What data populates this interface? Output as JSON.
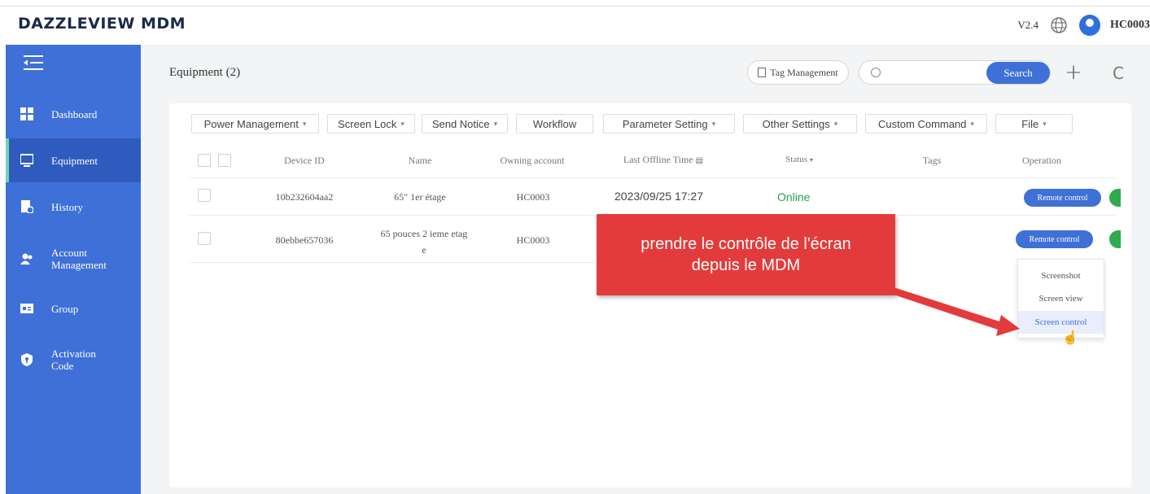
{
  "header": {
    "brand": "DAZZLEVIEW MDM",
    "version": "V2.4",
    "user": "HC0003"
  },
  "sidebar": {
    "items": [
      {
        "label": "Dashboard",
        "icon": "dashboard-icon"
      },
      {
        "label": "Equipment",
        "icon": "monitor-icon",
        "active": true
      },
      {
        "label": "History",
        "icon": "history-icon"
      },
      {
        "label": "Account\nManagement",
        "label_line1": "Account",
        "label_line2": "Management",
        "icon": "account-icon"
      },
      {
        "label": "Group",
        "icon": "group-icon"
      },
      {
        "label": "Activation\nCode",
        "label_line1": "Activation",
        "label_line2": "Code",
        "icon": "shield-icon"
      }
    ]
  },
  "main": {
    "title": "Equipment (2)",
    "tag_management": "Tag Management",
    "search_placeholder": "",
    "search_label": "Search",
    "plus": "+",
    "refresh": "C"
  },
  "toolbar": [
    {
      "label": "Power Management",
      "dropdown": true
    },
    {
      "label": "Screen Lock",
      "dropdown": true
    },
    {
      "label": "Send Notice",
      "dropdown": true
    },
    {
      "label": "Workflow",
      "dropdown": false
    },
    {
      "label": "Parameter Setting",
      "dropdown": true
    },
    {
      "label": "Other Settings",
      "dropdown": true
    },
    {
      "label": "Custom Command",
      "dropdown": true
    },
    {
      "label": "File",
      "dropdown": true
    }
  ],
  "table": {
    "columns": [
      "Device ID",
      "Name",
      "Owning account",
      "Last Offline Time",
      "Status",
      "Tags",
      "Operation"
    ],
    "rows": [
      {
        "device_id": "10b232604aa2",
        "name": "65\" 1er étage",
        "owner": "HC0003",
        "last_offline": "2023/09/25 17:27",
        "status": "Online",
        "tags": "",
        "operation": "Remote control"
      },
      {
        "device_id": "80ebbe657036",
        "name_line1": "65 pouces 2 ieme etag",
        "name_line2": "e",
        "owner": "HC0003",
        "last_offline": "",
        "status": "",
        "tags": "",
        "operation": "Remote control"
      }
    ]
  },
  "remote_menu": {
    "items": [
      "Screenshot",
      "Screen view",
      "Screen control"
    ],
    "highlighted": "Screen control"
  },
  "callout": {
    "line1": "prendre le contrôle de l'écran",
    "line2": "depuis le MDM"
  },
  "colors": {
    "sidebar": "#3f70d8",
    "accent": "#3f70d8",
    "online": "#27a14b",
    "callout": "#e33b3b"
  }
}
